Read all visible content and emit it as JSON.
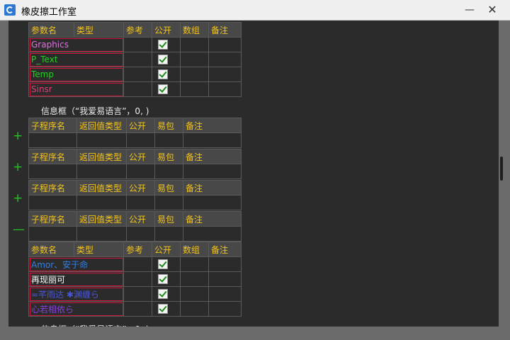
{
  "window": {
    "title": "橡皮擦工作室",
    "min_glyph": "—",
    "close_glyph": "✕"
  },
  "params_header": [
    "参数名",
    "类型",
    "参考",
    "公开",
    "数组",
    "备注"
  ],
  "sub_header": [
    "子程序名",
    "返回值类型",
    "公开",
    "易包",
    "备注"
  ],
  "params_top": [
    {
      "name": "Graphics",
      "color": "#e66ce6"
    },
    {
      "name": "P_Text",
      "color": "#22d022"
    },
    {
      "name": "Temp",
      "color": "#22d022"
    },
    {
      "name": "Sinsr",
      "color": "#e0407a"
    }
  ],
  "statement": "信息框（“我爱易语言”，0, )",
  "params_bottom": [
    {
      "name": "Amor、安于命",
      "color": "#2f7fe6"
    },
    {
      "name": "再现丽可",
      "color": "#ffffff"
    },
    {
      "name": "≈芊雨达 ✱渊缠ら",
      "color": "#4a56d8"
    },
    {
      "name": "心若相依ら",
      "color": "#8a3ee0"
    }
  ],
  "expanders": [
    "+",
    "+",
    "+",
    "—"
  ],
  "colors": {
    "header_text": "#f5c518",
    "grid_line": "#5a5a5a",
    "highlight_border": "#d0153a",
    "expander": "#22c322"
  },
  "icons": [
    "app-icon",
    "minimize-icon",
    "close-icon",
    "checkbox-checked-icon",
    "expand-icon",
    "collapse-icon"
  ]
}
